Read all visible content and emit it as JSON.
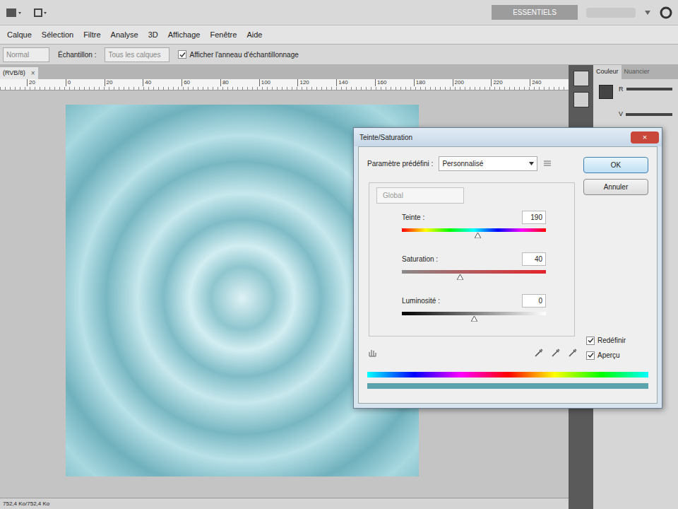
{
  "app_bar": {
    "workspace_button": "ESSENTIELS"
  },
  "menu": [
    "Calque",
    "Sélection",
    "Filtre",
    "Analyse",
    "3D",
    "Affichage",
    "Fenêtre",
    "Aide"
  ],
  "options_bar": {
    "mode": "Normal",
    "sample_label": "Échantillon :",
    "sample_value": "Tous les calques",
    "ring": {
      "label": "Afficher l'anneau d'échantillonnage",
      "checked": true
    }
  },
  "document": {
    "tab": "(RVB/8)",
    "close": "×",
    "status": "752,4 Ko/752,4 Ko"
  },
  "ruler": [
    "20",
    "0",
    "20",
    "40",
    "60",
    "80",
    "100",
    "120",
    "140",
    "160",
    "180",
    "200",
    "220",
    "240"
  ],
  "panels": {
    "tabs": [
      {
        "label": "Couleur",
        "selected": true
      },
      {
        "label": "Nuancier",
        "selected": false
      }
    ],
    "channels": [
      "R",
      "V"
    ]
  },
  "dialog": {
    "title": "Teinte/Saturation",
    "close": "×",
    "preset_label": "Paramètre prédéfini :",
    "preset_value": "Personnalisé",
    "buttons": [
      {
        "label": "OK",
        "selected": true
      },
      {
        "label": "Annuler",
        "selected": false
      }
    ],
    "channel": "Global",
    "sliders": [
      {
        "label": "Teinte :",
        "value": "190",
        "level": 0.525,
        "kind": "hue"
      },
      {
        "label": "Saturation :",
        "value": "40",
        "level": 0.4,
        "kind": "saturation"
      },
      {
        "label": "Luminosité :",
        "value": "0",
        "level": 0.5,
        "kind": "lightness"
      }
    ],
    "checkboxes": [
      {
        "label": "Redéfinir",
        "checked": true
      },
      {
        "label": "Aperçu",
        "checked": true
      }
    ]
  }
}
